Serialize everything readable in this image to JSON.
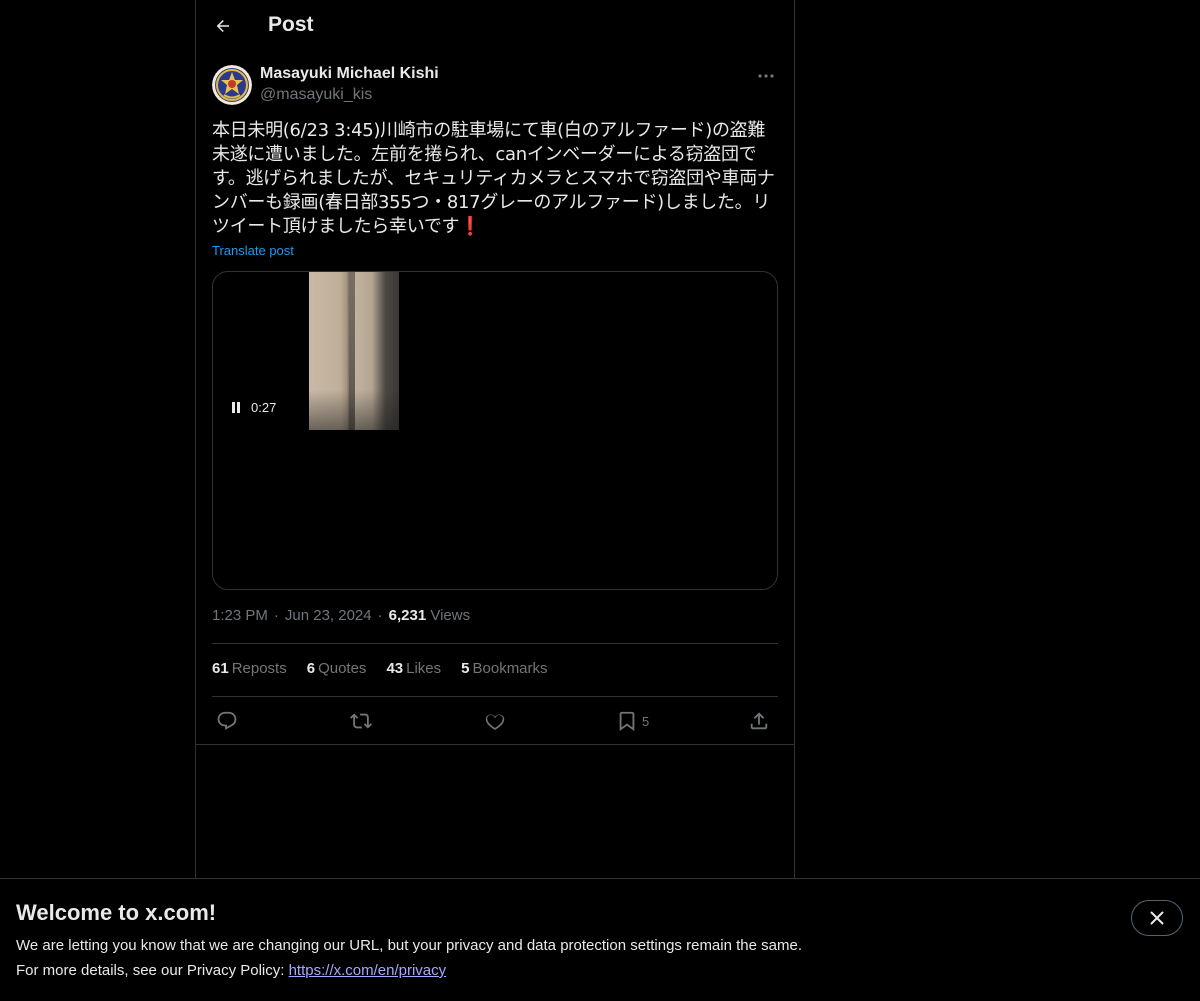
{
  "header": {
    "title": "Post",
    "back_icon": "arrow-left-icon"
  },
  "author": {
    "display_name": "Masayuki Michael Kishi",
    "handle": "@masayuki_kis",
    "avatar_icon": "crest-emblem"
  },
  "post": {
    "text": "本日未明(6/23 3:45)川崎市の駐車場にて車(白のアルファード)の盗難未遂に遭いました。左前を捲られ、canインベーダーによる窃盗団です。逃げられましたが、セキュリティカメラとスマホで窃盗団や車両ナンバーも録画(春日部355つ・817グレーのアルファード)しました。リツイート頂けましたら幸いです❗️",
    "translate_label": "Translate post",
    "video_time": "0:27",
    "time": "1:23 PM",
    "date": "Jun 23, 2024",
    "views_count": "6,231",
    "views_label": "Views"
  },
  "stats": [
    {
      "count": "61",
      "label": "Reposts"
    },
    {
      "count": "6",
      "label": "Quotes"
    },
    {
      "count": "43",
      "label": "Likes"
    },
    {
      "count": "5",
      "label": "Bookmarks"
    }
  ],
  "actions": {
    "bookmark_count": "5"
  },
  "banner": {
    "title": "Welcome to x.com!",
    "line1": "We are letting you know that we are changing our URL, but your privacy and data protection settings remain the same.",
    "line2_prefix": "For more details, see our Privacy Policy: ",
    "link": "https://x.com/en/privacy"
  },
  "colors": {
    "background": "#000000",
    "text": "#e7e9ea",
    "muted": "#71767b",
    "accent": "#1d9bf0",
    "border": "#2f3336"
  }
}
